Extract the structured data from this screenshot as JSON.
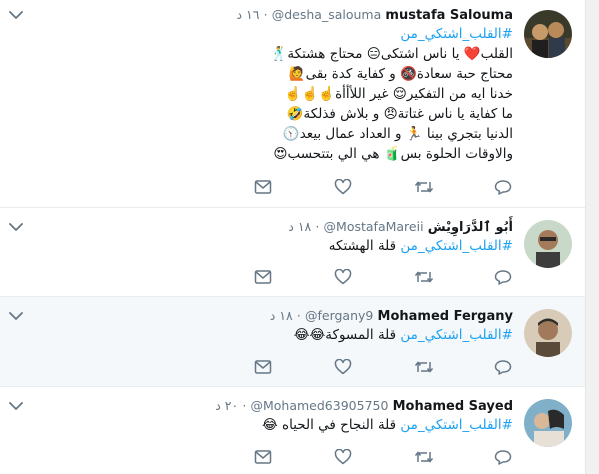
{
  "tweets": [
    {
      "name": "mustafa Salouma",
      "handle": "@desha_salouma",
      "sep": "·",
      "time": "١٦ د",
      "hashtag": "#القلب_اشتكي_من",
      "lines": [
        "القلب❤️ يا ناس اشتكى😑 محتاج هشتكة🕺",
        "محتاج حبة سعادة🚳 و كفاية كدة بقى🙋",
        "خدنا ايه من التفكير😌 غير اللأأأة☝️☝️☝️",
        "ما كفاية يا ناس غتاتة😠 و بلاش فذلكة🤣",
        "الدنيا بتجري بينا 🏃 و العداد عمال بيعد🕥",
        "والاوقات الحلوة بس🧃 هي الي بتتحسب😍"
      ],
      "avatar_colors": [
        "#3a3a2a",
        "#6b5a3e",
        "#c79a6a"
      ]
    },
    {
      "name": "أَبُو ٱلدَّرَاوِيْش",
      "handle": "@MostafaMareii",
      "sep": "·",
      "time": "١٨ د",
      "hashtag": "#القلب_اشتكي_من",
      "lines": [
        "قلة الهشتكه"
      ],
      "avatar_colors": [
        "#c9d9c9",
        "#8aa08a",
        "#3d3d3d"
      ]
    },
    {
      "name": "Mohamed Fergany",
      "handle": "@fergany9",
      "sep": "·",
      "time": "١٨ د",
      "hashtag": "#القلب_اشتكي_من",
      "lines": [
        "قلة المسوكة😂😂"
      ],
      "avatar_colors": [
        "#d8cbb8",
        "#a07a5a",
        "#2c2c2c"
      ]
    },
    {
      "name": "Mohamed Sayed",
      "handle": "@Mohamed63905750",
      "sep": "·",
      "time": "٢٠ د",
      "hashtag": "#القلب_اشتكي_من",
      "lines": [
        "قلة النجاح في الحياه 😂"
      ],
      "avatar_colors": [
        "#7fb0c8",
        "#d9c7b0",
        "#2a2a2a"
      ]
    }
  ],
  "colors": {
    "accent": "#1da1f2",
    "muted": "#657786",
    "icon": "#657786",
    "alt_bg": "#f5f8fa",
    "divider": "#e6ecf0"
  },
  "icons": [
    "chevron-down-icon",
    "reply-icon",
    "retweet-icon",
    "like-icon",
    "direct-message-icon"
  ]
}
